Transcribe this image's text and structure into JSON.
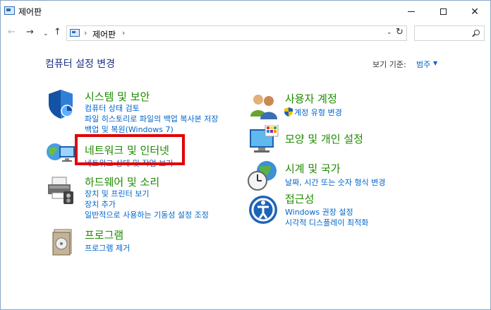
{
  "window": {
    "title": "제어판",
    "minimize_glyph": "",
    "maximize_glyph": "",
    "close_glyph": "✕"
  },
  "nav": {
    "back": "←",
    "forward": "→",
    "recent": "⌄",
    "up": "↑",
    "breadcrumb_sep": "›",
    "breadcrumb": "제어판",
    "dropdown": "⌄",
    "refresh": "↻",
    "search_placeholder": ""
  },
  "main": {
    "heading": "컴퓨터 설정 변경",
    "view_by_label": "보기 기준:",
    "view_by_value": "범주",
    "view_by_arrow": "▼"
  },
  "categories_left": [
    {
      "icon": "shield-icon",
      "title": "시스템 및 보안",
      "links": [
        "컴퓨터 상태 검토",
        "파일 히스토리로 파일의 백업 복사본 저장",
        "백업 및 복원(Windows 7)"
      ]
    },
    {
      "icon": "network-icon",
      "title": "네트워크 및 인터넷",
      "links": [
        "네트워크 상태 및 작업 보기"
      ]
    },
    {
      "icon": "printer-icon",
      "title": "하드웨어 및 소리",
      "links": [
        "장치 및 프린터 보기",
        "장치 추가",
        "일반적으로 사용하는 기동성 설정 조정"
      ]
    },
    {
      "icon": "programs-icon",
      "title": "프로그램",
      "links": [
        "프로그램 제거"
      ]
    }
  ],
  "categories_right": [
    {
      "icon": "users-icon",
      "title": "사용자 계정",
      "links": [
        "계정 유형 변경"
      ]
    },
    {
      "icon": "appearance-icon",
      "title": "모양 및 개인 설정",
      "links": []
    },
    {
      "icon": "clock-globe-icon",
      "title": "시계 및 국가",
      "links": [
        "날짜, 시간 또는 숫자 형식 변경"
      ]
    },
    {
      "icon": "accessibility-icon",
      "title": "접근성",
      "links": [
        "Windows 권장 설정",
        "시각적 디스플레이 최적화"
      ]
    }
  ],
  "colors": {
    "category_title": "#1e8a00",
    "link": "#0066cc",
    "heading": "#1e3287",
    "highlight_box": "#e00000"
  }
}
